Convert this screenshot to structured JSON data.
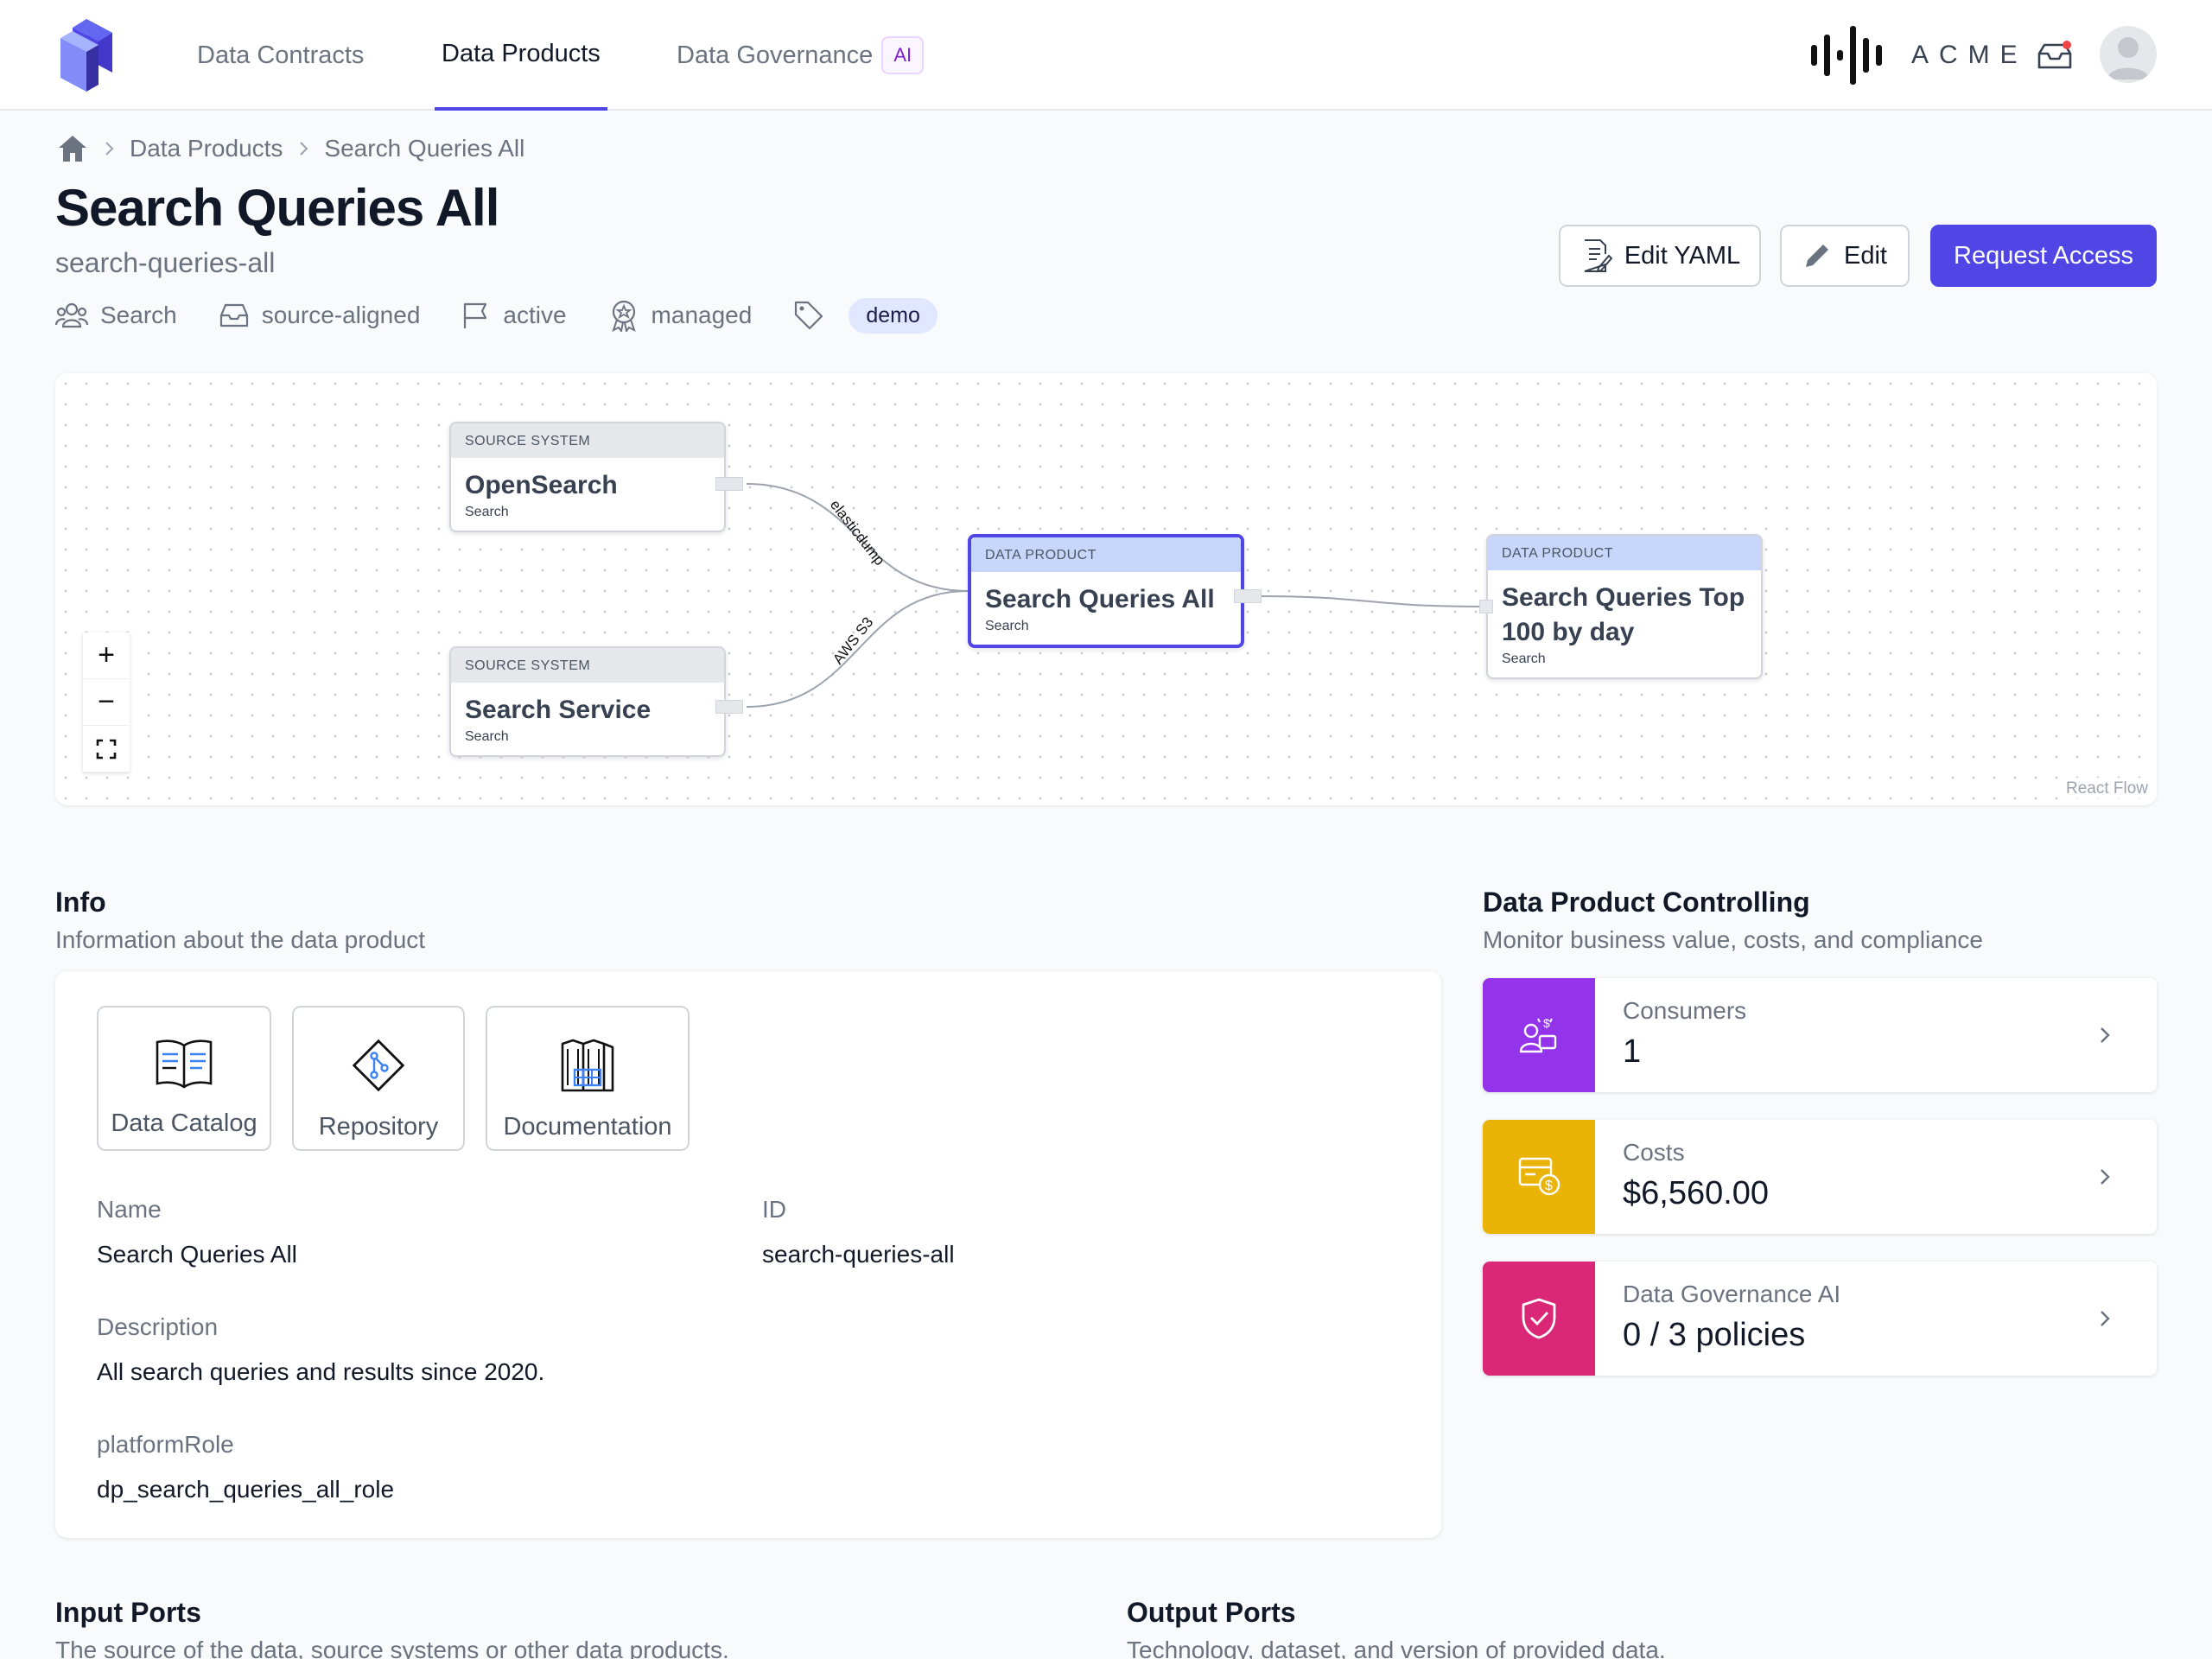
{
  "nav": {
    "tabs": [
      {
        "label": "Data Contracts"
      },
      {
        "label": "Data Products"
      },
      {
        "label": "Data Governance"
      }
    ],
    "ai_badge": "AI",
    "brand": "ACME",
    "accent": "#4f46e5"
  },
  "breadcrumb": {
    "items": [
      "Data Products",
      "Search Queries All"
    ]
  },
  "header": {
    "title": "Search Queries All",
    "subtitle": "search-queries-all",
    "meta": {
      "team": "Search",
      "kind": "source-aligned",
      "status": "active",
      "ownership": "managed",
      "tag": "demo"
    },
    "buttons": {
      "edit_yaml": "Edit YAML",
      "edit": "Edit",
      "request_access": "Request Access"
    }
  },
  "flow": {
    "nodes": [
      {
        "type": "SOURCE SYSTEM",
        "name": "OpenSearch",
        "domain": "Search"
      },
      {
        "type": "SOURCE SYSTEM",
        "name": "Search Service",
        "domain": "Search"
      },
      {
        "type": "DATA PRODUCT",
        "name": "Search Queries All",
        "domain": "Search"
      },
      {
        "type": "DATA PRODUCT",
        "name": "Search Queries Top 100 by day",
        "domain": "Search"
      }
    ],
    "edge_labels": [
      "elasticdump",
      "AWS S3"
    ],
    "controls": {
      "zoom_in": "+",
      "zoom_out": "−"
    },
    "attribution": "React Flow"
  },
  "info": {
    "title": "Info",
    "subtitle": "Information about the data product",
    "links": [
      "Data Catalog",
      "Repository",
      "Documentation"
    ],
    "fields": {
      "name_label": "Name",
      "name_value": "Search Queries All",
      "id_label": "ID",
      "id_value": "search-queries-all",
      "description_label": "Description",
      "description_value": "All search queries and results since 2020.",
      "role_label": "platformRole",
      "role_value": "dp_search_queries_all_role"
    }
  },
  "controlling": {
    "title": "Data Product Controlling",
    "subtitle": "Monitor business value, costs, and compliance",
    "cards": [
      {
        "label": "Consumers",
        "value": "1",
        "color": "#9333ea",
        "icon": "consumers-icon"
      },
      {
        "label": "Costs",
        "value": "$6,560.00",
        "color": "#eab308",
        "icon": "costs-icon"
      },
      {
        "label": "Data Governance AI",
        "value": "0 / 3 policies",
        "color": "#db2777",
        "icon": "shield-check-icon"
      }
    ]
  },
  "input_ports": {
    "title": "Input Ports",
    "subtitle": "The source of the data, source systems or other data products."
  },
  "output_ports": {
    "title": "Output Ports",
    "subtitle": "Technology, dataset, and version of provided data."
  }
}
